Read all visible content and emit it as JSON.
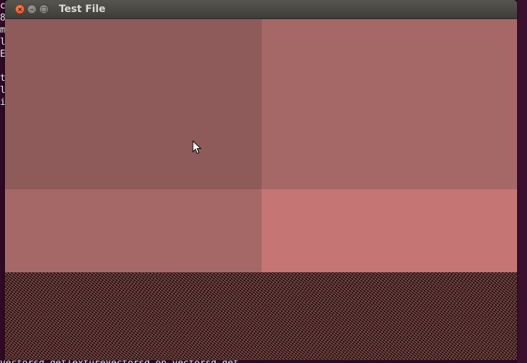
{
  "window": {
    "title": "Test File",
    "controls": {
      "close_glyph": "×",
      "minimize_glyph": "–",
      "maximize_glyph": "□"
    }
  },
  "content": {
    "quadrant_colors": {
      "top_left": "#8f5b5a",
      "top_right": "#a66867",
      "bottom_left": "#a66867",
      "bottom_right": "#c47574"
    },
    "noise_colors": {
      "dark": "#0d0606",
      "light": "#c47574"
    }
  },
  "background_terminal": {
    "left_column_chars": [
      "c",
      "8",
      "m",
      "l",
      "E",
      "",
      "t",
      "l",
      "i"
    ],
    "bottom_line": "vectorsd getTextureVectorsd on.vectorsd get"
  },
  "colors": {
    "terminal_bg": "#300a24",
    "titlebar_top": "#56554f",
    "titlebar_bottom": "#3e3d39",
    "title_text": "#dfdbd2",
    "close_button": "#e0461a"
  },
  "cursor": {
    "icon": "arrow-pointer-icon"
  }
}
